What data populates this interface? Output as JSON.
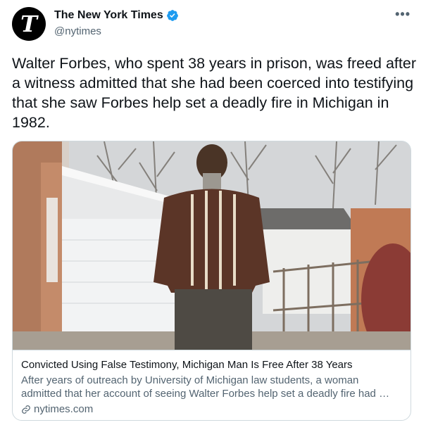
{
  "author": {
    "display_name": "The New York Times",
    "handle": "@nytimes",
    "avatar_glyph": "T",
    "verified_color": "#1d9bf0"
  },
  "menu": {
    "more_label": "•••"
  },
  "tweet": {
    "text": "Walter Forbes, who spent 38 years in prison, was freed after a witness admitted that she had been coerced into testifying that she saw Forbes help set a deadly fire in Michigan in 1982."
  },
  "card": {
    "title": "Convicted Using False Testimony, Michigan Man Is Free After 38 Years",
    "description": "After years of outreach by University of Michigan law students, a woman admitted that her account of seeing Walter Forbes help set a deadly fire had …",
    "domain": "nytimes.com",
    "domain_icon": "link-icon"
  },
  "colors": {
    "text": "#0f1419",
    "secondary": "#536471",
    "border": "#cfd9de"
  }
}
